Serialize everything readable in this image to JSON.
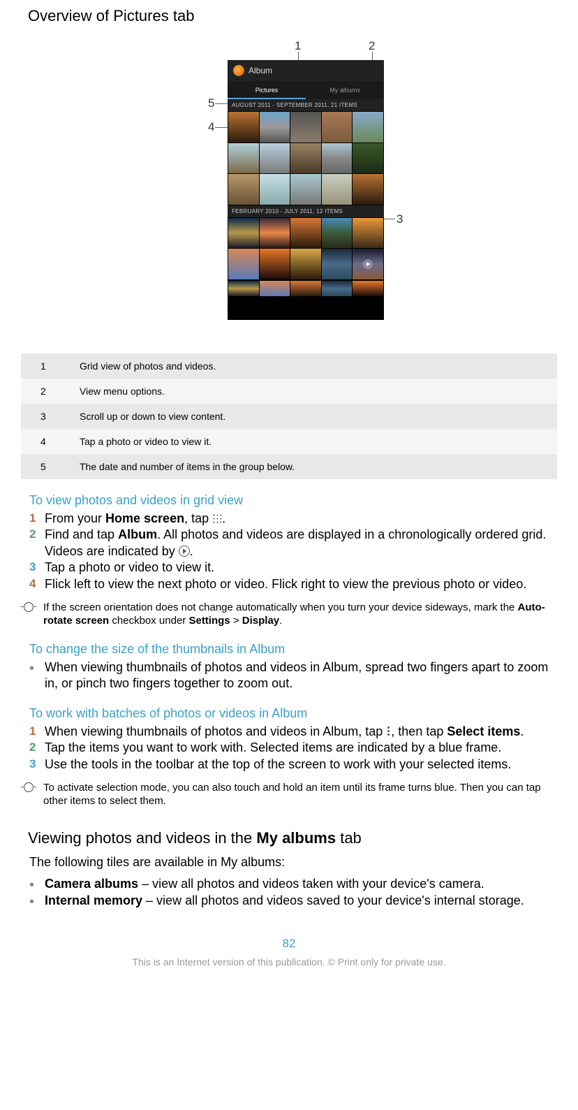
{
  "heading1": "Overview of Pictures tab",
  "phone": {
    "title": "Album",
    "tab1": "Pictures",
    "tab2": "My albums",
    "group1": "AUGUST 2011 - SEPTEMBER 2011, 21 ITEMS",
    "group2": "FEBRUARY 2010 - JULY 2011, 12 ITEMS"
  },
  "callouts": {
    "c1": "1",
    "c2": "2",
    "c3": "3",
    "c4": "4",
    "c5": "5"
  },
  "legend": [
    {
      "n": "1",
      "t": "Grid view of photos and videos."
    },
    {
      "n": "2",
      "t": "View menu options."
    },
    {
      "n": "3",
      "t": "Scroll up or down to view content."
    },
    {
      "n": "4",
      "t": "Tap a photo or video to view it."
    },
    {
      "n": "5",
      "t": "The date and number of items in the group below."
    }
  ],
  "sec1_title": "To view photos and videos in grid view",
  "sec1": {
    "s1a": "From your ",
    "s1b": "Home screen",
    "s1c": ", tap ",
    "s1d": ".",
    "s2a": "Find and tap ",
    "s2b": "Album",
    "s2c": ". All photos and videos are displayed in a chronologically ordered grid. Videos are indicated by ",
    "s2d": ".",
    "s3": "Tap a photo or video to view it.",
    "s4": "Flick left to view the next photo or video. Flick right to view the previous photo or video."
  },
  "tip1a": "If the screen orientation does not change automatically when you turn your device sideways, mark the ",
  "tip1b": "Auto-rotate screen",
  "tip1c": " checkbox under ",
  "tip1d": "Settings",
  "tip1e": " > ",
  "tip1f": "Display",
  "tip1g": ".",
  "sec2_title": "To change the size of the thumbnails in Album",
  "sec2_b1": "When viewing thumbnails of photos and videos in Album, spread two fingers apart to zoom in, or pinch two fingers together to zoom out.",
  "sec3_title": "To work with batches of photos or videos in Album",
  "sec3": {
    "s1a": "When viewing thumbnails of photos and videos in Album, tap ",
    "s1b": ", then tap ",
    "s1c": "Select items",
    "s1d": ".",
    "s2": "Tap the items you want to work with. Selected items are indicated by a blue frame.",
    "s3": "Use the tools in the toolbar at the top of the screen to work with your selected items."
  },
  "tip2": "To activate selection mode, you can also touch and hold an item until its frame turns blue. Then you can tap other items to select them.",
  "heading2a": "Viewing photos and videos in the ",
  "heading2b": "My albums",
  "heading2c": " tab",
  "intro2": "The following tiles are available in My albums:",
  "albums": {
    "b1a": "Camera albums",
    "b1b": " – view all photos and videos taken with your device's camera.",
    "b2a": "Internal memory",
    "b2b": " – view all photos and videos saved to your device's internal storage."
  },
  "page_number": "82",
  "footer": "This is an Internet version of this publication. © Print only for private use."
}
